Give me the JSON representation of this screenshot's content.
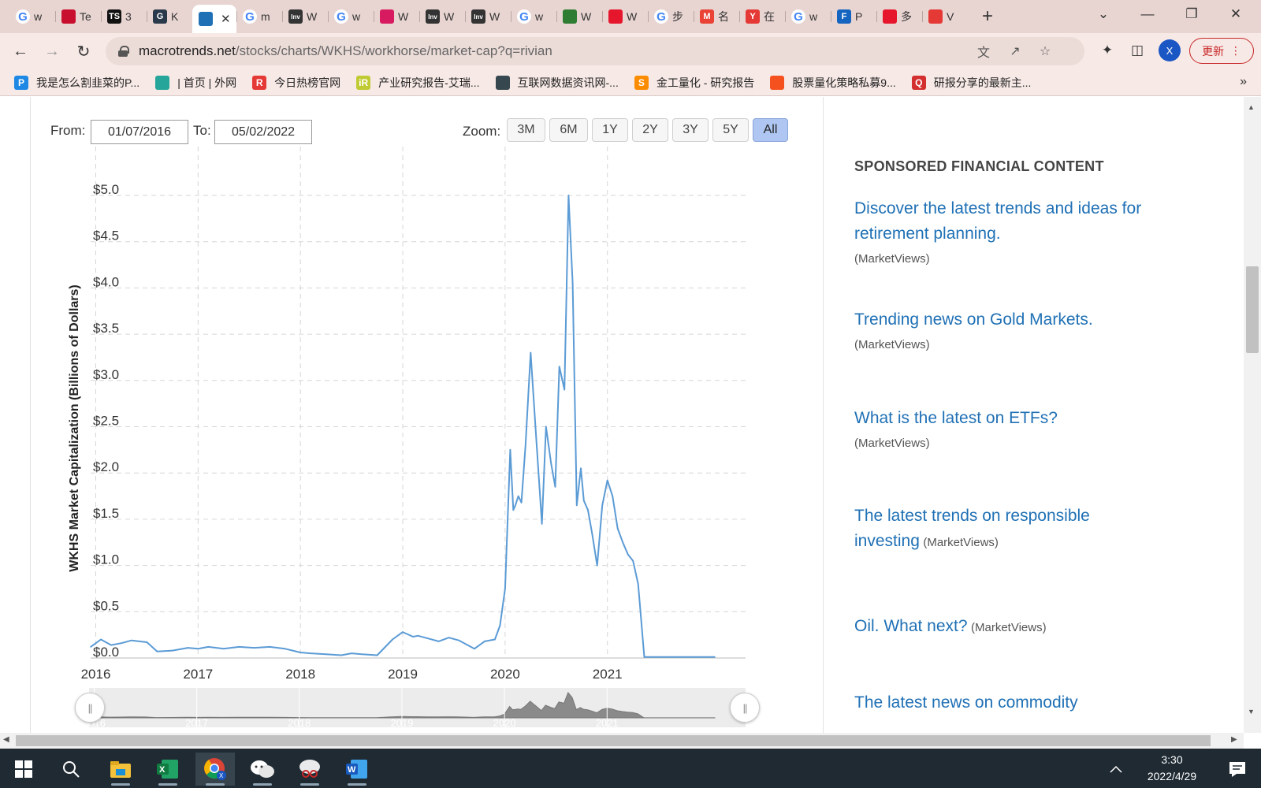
{
  "browser": {
    "tabs": [
      {
        "icon": "google-icon",
        "color": "#4285f4",
        "glyph": "G",
        "title": "w"
      },
      {
        "icon": "flag-icon",
        "color": "#c8102e",
        "glyph": "",
        "title": "Te"
      },
      {
        "icon": "ts-icon",
        "color": "#111111",
        "glyph": "TS",
        "title": "3"
      },
      {
        "icon": "gbz-icon",
        "color": "#2b3a4a",
        "glyph": "G",
        "title": "K"
      },
      {
        "icon": "macrotrends-icon",
        "color": "#1f70b5",
        "glyph": "",
        "title": "",
        "active": true
      },
      {
        "icon": "google-icon",
        "color": "#4285f4",
        "glyph": "G",
        "title": "m"
      },
      {
        "icon": "investing-icon",
        "color": "#333333",
        "glyph": "Inv",
        "title": "W"
      },
      {
        "icon": "google-icon",
        "color": "#4285f4",
        "glyph": "G",
        "title": "w"
      },
      {
        "icon": "bird-icon",
        "color": "#d81b60",
        "glyph": "",
        "title": "W"
      },
      {
        "icon": "investing-icon",
        "color": "#333333",
        "glyph": "Inv",
        "title": "W"
      },
      {
        "icon": "investing-icon",
        "color": "#333333",
        "glyph": "Inv",
        "title": "W"
      },
      {
        "icon": "google-icon",
        "color": "#4285f4",
        "glyph": "G",
        "title": "w"
      },
      {
        "icon": "chart-app-icon",
        "color": "#2e7d32",
        "glyph": "",
        "title": "W"
      },
      {
        "icon": "weibo-icon",
        "color": "#e6162d",
        "glyph": "",
        "title": "W"
      },
      {
        "icon": "google-icon",
        "color": "#4285f4",
        "glyph": "G",
        "title": "步"
      },
      {
        "icon": "gmail-icon",
        "color": "#ea4335",
        "glyph": "M",
        "title": "名"
      },
      {
        "icon": "y-icon",
        "color": "#e53935",
        "glyph": "Y",
        "title": "在"
      },
      {
        "icon": "google-icon",
        "color": "#4285f4",
        "glyph": "G",
        "title": "w"
      },
      {
        "icon": "fe-icon",
        "color": "#1565c0",
        "glyph": "F",
        "title": "P"
      },
      {
        "icon": "weibo-icon",
        "color": "#e6162d",
        "glyph": "",
        "title": "多"
      },
      {
        "icon": "red-app-icon",
        "color": "#e53935",
        "glyph": "",
        "title": "V"
      }
    ],
    "tab_close": "✕",
    "new_tab": "+",
    "url_host": "macrotrends.net",
    "url_path": "/stocks/charts/WKHS/workhorse/market-cap?q=rivian",
    "profile_initial": "X",
    "update_label": "更新",
    "bookmarks": [
      {
        "icon": "p-icon",
        "color": "#1e88e5",
        "glyph": "P",
        "label": "我是怎么割韭菜的P..."
      },
      {
        "icon": "bird-bm-icon",
        "color": "#26a69a",
        "glyph": "",
        "label": "| 首页 | 外网"
      },
      {
        "icon": "r-icon",
        "color": "#e53935",
        "glyph": "R",
        "label": "今日热榜官网"
      },
      {
        "icon": "ir-icon",
        "color": "#c0ca33",
        "glyph": "iR",
        "label": "产业研究报告-艾瑞..."
      },
      {
        "icon": "globe-icon",
        "color": "#37474f",
        "glyph": "",
        "label": "互联网数据资讯网-..."
      },
      {
        "icon": "s-icon",
        "color": "#fb8c00",
        "glyph": "S",
        "label": "金工量化 - 研究报告"
      },
      {
        "icon": "flame-icon",
        "color": "#f4511e",
        "glyph": "",
        "label": "股票量化策略私募9..."
      },
      {
        "icon": "q-icon",
        "color": "#d32f2f",
        "glyph": "Q",
        "label": "研报分享的最新主..."
      }
    ],
    "bookmarks_more": "»"
  },
  "controls": {
    "from_label": "From:",
    "from_value": "01/07/2016",
    "to_label": "To:",
    "to_value": "05/02/2022",
    "zoom_label": "Zoom:",
    "zoom_options": [
      "3M",
      "6M",
      "1Y",
      "2Y",
      "3Y",
      "5Y",
      "All"
    ],
    "zoom_selected": "All"
  },
  "chart_data": {
    "type": "line",
    "title": "",
    "xlabel": "",
    "ylabel": "WKHS Market Capitalization (Billions of Dollars)",
    "ylim": [
      0,
      5
    ],
    "y_ticks": [
      "$0.0",
      "$0.5",
      "$1.0",
      "$1.5",
      "$2.0",
      "$2.5",
      "$3.0",
      "$3.5",
      "$4.0",
      "$4.5",
      "$5.0"
    ],
    "x_ticks": [
      "2016",
      "2017",
      "2018",
      "2019",
      "2020",
      "2021"
    ],
    "grid": true,
    "color": "#5b9bd5",
    "x": [
      2015.95,
      2016.05,
      2016.15,
      2016.25,
      2016.35,
      2016.5,
      2016.6,
      2016.75,
      2016.9,
      2017.0,
      2017.1,
      2017.25,
      2017.4,
      2017.55,
      2017.7,
      2017.85,
      2018.0,
      2018.1,
      2018.25,
      2018.4,
      2018.5,
      2018.6,
      2018.75,
      2018.9,
      2019.0,
      2019.1,
      2019.15,
      2019.25,
      2019.35,
      2019.45,
      2019.55,
      2019.7,
      2019.8,
      2019.9,
      2019.95,
      2020.0,
      2020.05,
      2020.08,
      2020.1,
      2020.13,
      2020.16,
      2020.2,
      2020.25,
      2020.3,
      2020.36,
      2020.4,
      2020.45,
      2020.49,
      2020.53,
      2020.58,
      2020.62,
      2020.66,
      2020.7,
      2020.74,
      2020.77,
      2020.81,
      2020.85,
      2020.9,
      2020.95,
      2021.0,
      2021.05,
      2021.1,
      2021.15,
      2021.2,
      2021.25,
      2021.3,
      2021.36,
      2021.45,
      2021.7,
      2021.95,
      2022.05
    ],
    "values": [
      0.12,
      0.2,
      0.14,
      0.16,
      0.19,
      0.17,
      0.07,
      0.08,
      0.11,
      0.1,
      0.12,
      0.1,
      0.12,
      0.11,
      0.12,
      0.1,
      0.06,
      0.05,
      0.04,
      0.03,
      0.05,
      0.04,
      0.03,
      0.2,
      0.28,
      0.23,
      0.24,
      0.21,
      0.18,
      0.22,
      0.19,
      0.1,
      0.18,
      0.2,
      0.35,
      0.75,
      2.25,
      1.6,
      1.65,
      1.75,
      1.68,
      2.3,
      3.3,
      2.45,
      1.45,
      2.5,
      2.1,
      1.85,
      3.15,
      2.9,
      5.0,
      4.05,
      1.65,
      2.05,
      1.7,
      1.6,
      1.35,
      1.0,
      1.65,
      1.92,
      1.75,
      1.4,
      1.25,
      1.12,
      1.05,
      0.8,
      0.01,
      0.01,
      0.01,
      0.01,
      0.01
    ]
  },
  "navigator": {
    "handle_glyph": "||"
  },
  "sponsored": {
    "heading": "SPONSORED FINANCIAL CONTENT",
    "items": [
      {
        "link": "Discover the latest trends and ideas for retirement planning.",
        "source": "(MarketViews)"
      },
      {
        "link": "Trending news on Gold Markets.",
        "source": "(MarketViews)"
      },
      {
        "link": "What is the latest on ETFs?",
        "source": "(MarketViews)"
      },
      {
        "link": "The latest trends on responsible investing",
        "source": "(MarketViews)"
      },
      {
        "link": "Oil. What next?",
        "source": "(MarketViews)"
      },
      {
        "link": "The latest news on commodity",
        "source": ""
      }
    ]
  },
  "taskbar": {
    "time": "3:30",
    "date": "2022/4/29"
  }
}
